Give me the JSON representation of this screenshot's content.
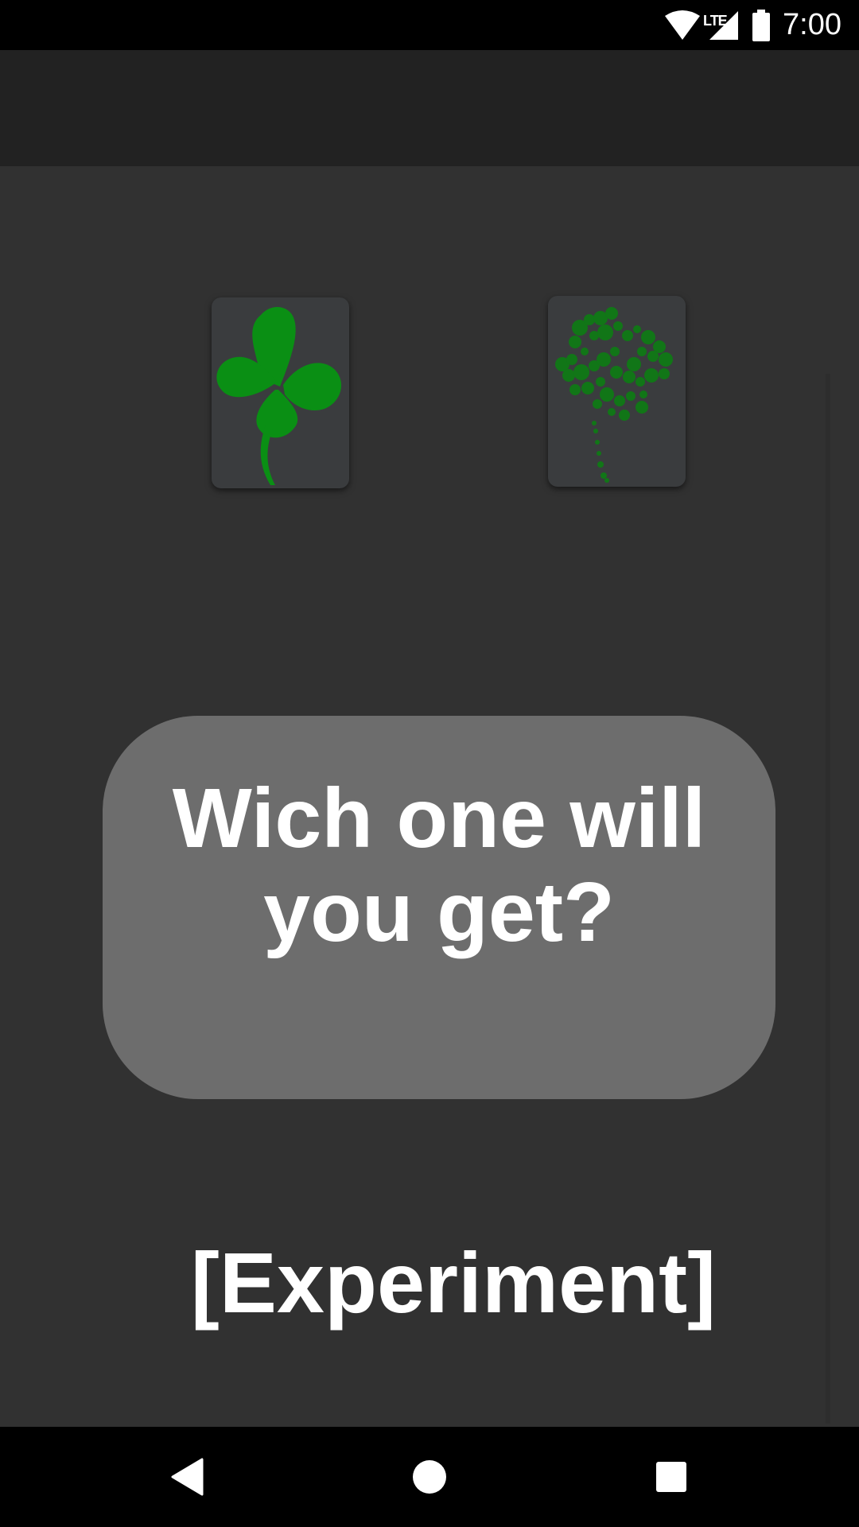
{
  "status_bar": {
    "network_label": "LTE",
    "time": "7:00",
    "icons": [
      "wifi-icon",
      "cell-signal-icon",
      "battery-icon"
    ]
  },
  "app_bar": {},
  "cards": [
    {
      "name": "solid-clover",
      "color": "#0a8f14"
    },
    {
      "name": "speckled-clover",
      "color": "#0f7a16"
    }
  ],
  "question": {
    "line1": "Wich one will",
    "line2": "you get?"
  },
  "experiment_label": "[Experiment]",
  "nav_bar": {
    "icons": [
      "back-icon",
      "home-icon",
      "recents-icon"
    ]
  },
  "colors": {
    "background": "#313131",
    "app_bar": "#222222",
    "card": "#3a3c3e",
    "question_box": "#6d6d6d",
    "clover_green": "#0a8f14",
    "text": "#ffffff"
  }
}
